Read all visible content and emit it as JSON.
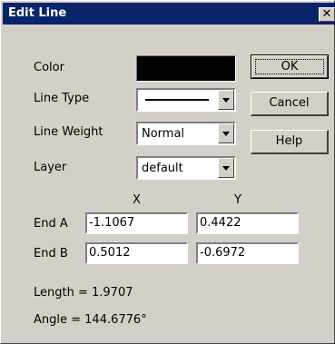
{
  "window": {
    "title": "Edit Line",
    "close_glyph": "✕"
  },
  "form": {
    "color_label": "Color",
    "color_value": "#000000",
    "line_type_label": "Line Type",
    "line_weight_label": "Line Weight",
    "line_weight_value": "Normal",
    "layer_label": "Layer",
    "layer_value": "default"
  },
  "buttons": {
    "ok": "OK",
    "cancel": "Cancel",
    "help": "Help"
  },
  "coords": {
    "x_header": "X",
    "y_header": "Y",
    "end_a_label": "End A",
    "end_a_x": "-1.1067",
    "end_a_y": "0.4422",
    "end_b_label": "End B",
    "end_b_x": "0.5012",
    "end_b_y": "-0.6972"
  },
  "results": {
    "length": "Length = 1.9707",
    "angle": "Angle = 144.6776°"
  }
}
